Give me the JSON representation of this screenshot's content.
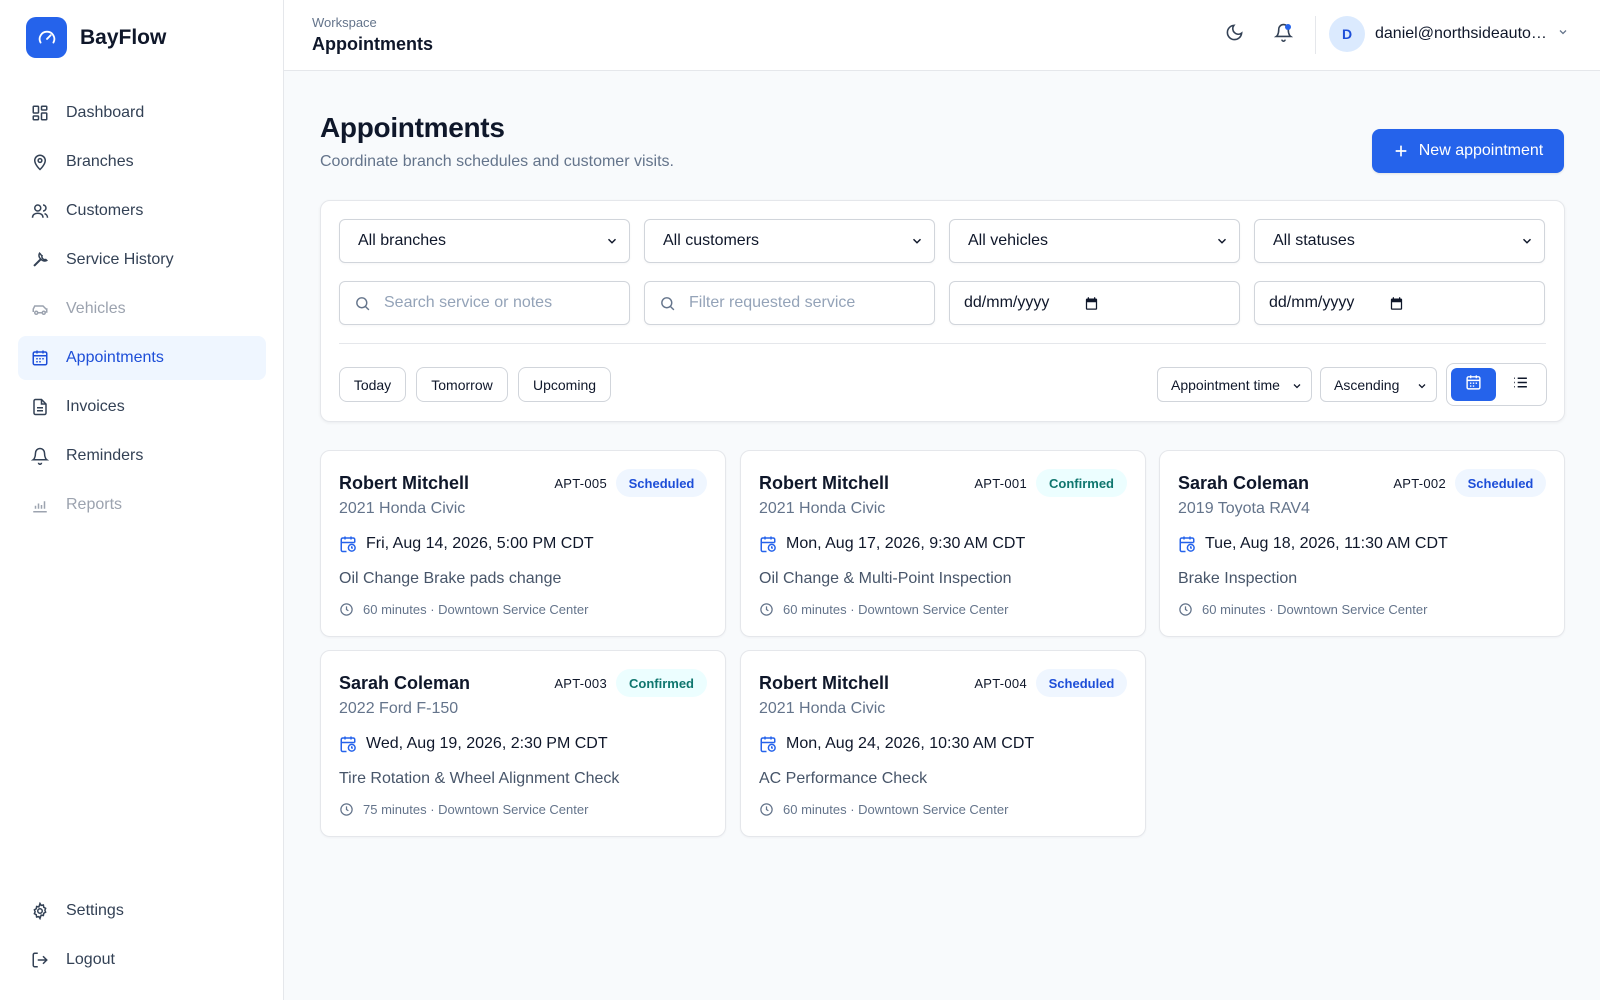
{
  "app": {
    "name": "BayFlow"
  },
  "sidebar": {
    "items": [
      {
        "label": "Dashboard",
        "icon": "dashboard-icon"
      },
      {
        "label": "Branches",
        "icon": "map-pin-icon"
      },
      {
        "label": "Customers",
        "icon": "users-icon"
      },
      {
        "label": "Service History",
        "icon": "wrench-icon"
      },
      {
        "label": "Vehicles",
        "icon": "car-icon",
        "disabled": true
      },
      {
        "label": "Appointments",
        "icon": "calendar-icon",
        "active": true
      },
      {
        "label": "Invoices",
        "icon": "file-text-icon"
      },
      {
        "label": "Reminders",
        "icon": "bell-icon"
      },
      {
        "label": "Reports",
        "icon": "bar-chart-icon",
        "disabled": true
      }
    ],
    "bottom": [
      {
        "label": "Settings",
        "icon": "gear-icon"
      },
      {
        "label": "Logout",
        "icon": "logout-icon"
      }
    ]
  },
  "header": {
    "breadcrumb": "Workspace",
    "title": "Appointments",
    "user_initial": "D",
    "user_email": "daniel@northsideautoservice.com"
  },
  "main": {
    "title": "Appointments",
    "subtitle": "Coordinate branch schedules and customer visits.",
    "new_button": "New appointment"
  },
  "filters": {
    "branch": "All branches",
    "customer": "All customers",
    "vehicle": "All vehicles",
    "status": "All statuses",
    "search_placeholder": "Search service or notes",
    "service_placeholder": "Filter requested service",
    "date_from": "dd/mm/yyyy",
    "date_to": "dd/mm/yyyy",
    "quick": [
      "Today",
      "Tomorrow",
      "Upcoming"
    ],
    "sort_field": "Appointment time",
    "sort_order": "Ascending",
    "view_mode": "calendar"
  },
  "colors": {
    "accent": "#2563eb",
    "scheduled_bg": "#eff6ff",
    "scheduled_fg": "#1d4ed8",
    "confirmed_bg": "#ecfeff",
    "confirmed_fg": "#0f766e"
  },
  "appointments": [
    {
      "customer": "Robert Mitchell",
      "id": "APT-005",
      "status": "Scheduled",
      "status_key": "scheduled",
      "vehicle": "2021 Honda Civic",
      "datetime": "Fri, Aug 14, 2026, 5:00 PM CDT",
      "service": "Oil Change Brake pads change",
      "meta": "60 minutes · Downtown Service Center"
    },
    {
      "customer": "Robert Mitchell",
      "id": "APT-001",
      "status": "Confirmed",
      "status_key": "confirmed",
      "vehicle": "2021 Honda Civic",
      "datetime": "Mon, Aug 17, 2026, 9:30 AM CDT",
      "service": "Oil Change & Multi-Point Inspection",
      "meta": "60 minutes · Downtown Service Center"
    },
    {
      "customer": "Sarah Coleman",
      "id": "APT-002",
      "status": "Scheduled",
      "status_key": "scheduled",
      "vehicle": "2019 Toyota RAV4",
      "datetime": "Tue, Aug 18, 2026, 11:30 AM CDT",
      "service": "Brake Inspection",
      "meta": "60 minutes · Downtown Service Center"
    },
    {
      "customer": "Sarah Coleman",
      "id": "APT-003",
      "status": "Confirmed",
      "status_key": "confirmed",
      "vehicle": "2022 Ford F-150",
      "datetime": "Wed, Aug 19, 2026, 2:30 PM CDT",
      "service": "Tire Rotation & Wheel Alignment Check",
      "meta": "75 minutes · Downtown Service Center"
    },
    {
      "customer": "Robert Mitchell",
      "id": "APT-004",
      "status": "Scheduled",
      "status_key": "scheduled",
      "vehicle": "2021 Honda Civic",
      "datetime": "Mon, Aug 24, 2026, 10:30 AM CDT",
      "service": "AC Performance Check",
      "meta": "60 minutes · Downtown Service Center"
    }
  ]
}
